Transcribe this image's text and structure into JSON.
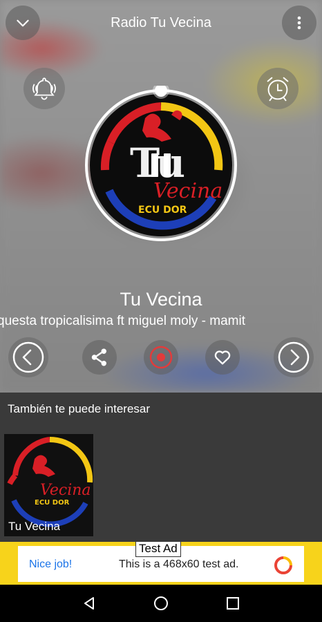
{
  "header": {
    "title": "Radio Tu Vecina",
    "left_icon": "chevron-down-icon",
    "right_icon": "more-vert-icon"
  },
  "player": {
    "left_action_icon": "bell-ring-icon",
    "right_action_icon": "alarm-clock-icon",
    "station_name": "Tu Vecina",
    "now_playing": "questa tropicalisima ft miguel moly - mamit",
    "state": "playing",
    "logo_alt": "Tu Vecina Ecuador logo"
  },
  "controls": {
    "previous_icon": "chevron-left-circle-icon",
    "share_icon": "share-icon",
    "record_icon": "record-icon",
    "favorite_icon": "heart-icon",
    "next_icon": "chevron-right-circle-icon"
  },
  "recommendations": {
    "heading": "También te puede interesar",
    "items": [
      {
        "name": "Tu Vecina"
      }
    ]
  },
  "ad": {
    "badge": "Test Ad",
    "cta": "Nice job!",
    "text": "This is a 468x60 test ad."
  },
  "colors": {
    "accent_red": "#e23b3b",
    "ad_yellow": "#f7d31b",
    "ad_link": "#1a73e8",
    "recs_bg": "#3a3a3a"
  },
  "android_nav": [
    "back-icon",
    "home-icon",
    "recents-icon"
  ]
}
